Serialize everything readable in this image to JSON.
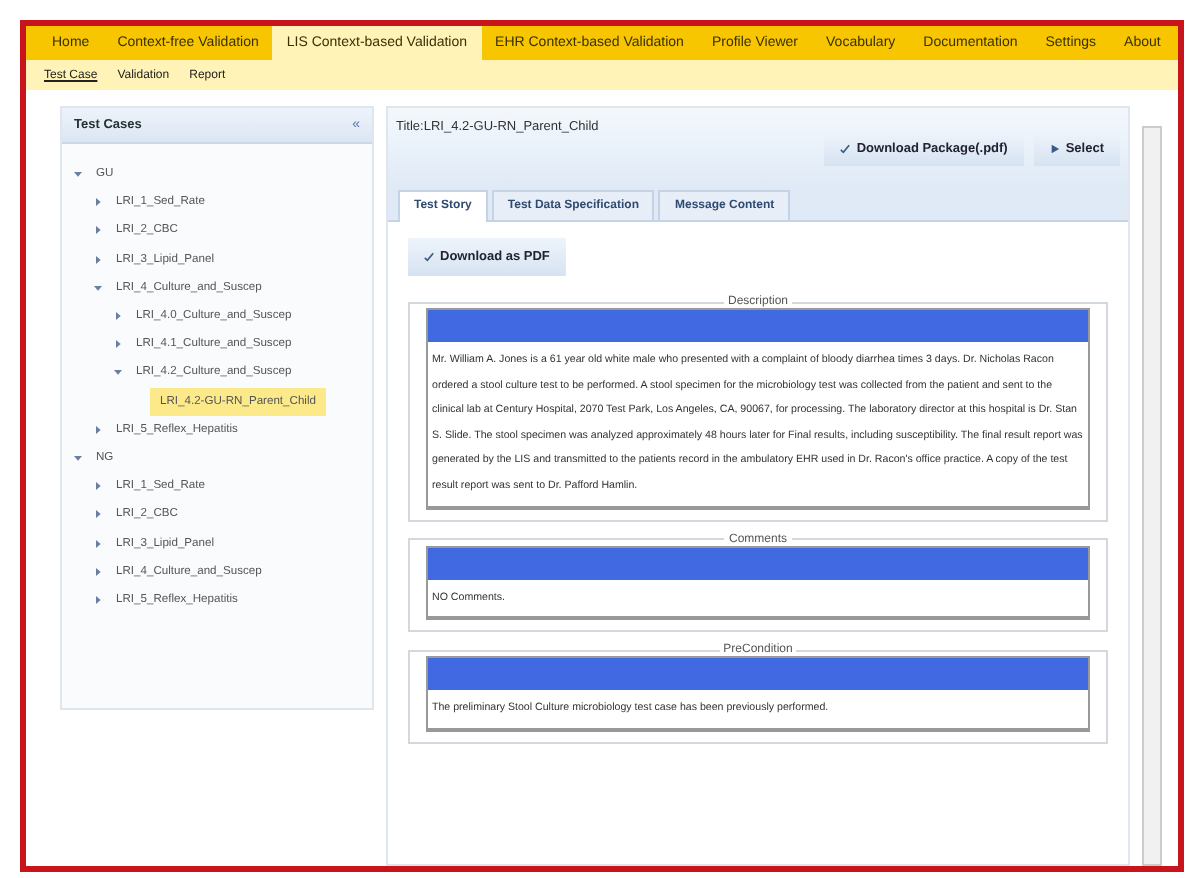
{
  "nav": [
    {
      "label": "Home",
      "selected": false
    },
    {
      "label": "Context-free Validation",
      "selected": false
    },
    {
      "label": "LIS Context-based Validation",
      "selected": true
    },
    {
      "label": "EHR Context-based Validation",
      "selected": false
    },
    {
      "label": "Profile Viewer",
      "selected": false
    },
    {
      "label": "Vocabulary",
      "selected": false
    },
    {
      "label": "Documentation",
      "selected": false
    },
    {
      "label": "Settings",
      "selected": false
    },
    {
      "label": "About",
      "selected": false
    }
  ],
  "subnav": [
    {
      "label": "Test Case",
      "selected": true
    },
    {
      "label": "Validation",
      "selected": false
    },
    {
      "label": "Report",
      "selected": false
    }
  ],
  "sidebar": {
    "title": "Test Cases",
    "collapse_icon": "«",
    "tree": [
      {
        "label": "GU",
        "expanded": true,
        "selected": false,
        "children": [
          {
            "label": "LRI_1_Sed_Rate",
            "expanded": false,
            "selected": false
          },
          {
            "label": "LRI_2_CBC",
            "expanded": false,
            "selected": false
          },
          {
            "label": "LRI_3_Lipid_Panel",
            "expanded": false,
            "selected": false
          },
          {
            "label": "LRI_4_Culture_and_Suscep",
            "expanded": true,
            "selected": false,
            "children": [
              {
                "label": "LRI_4.0_Culture_and_Suscep",
                "expanded": false,
                "selected": false
              },
              {
                "label": "LRI_4.1_Culture_and_Suscep",
                "expanded": false,
                "selected": false
              },
              {
                "label": "LRI_4.2_Culture_and_Suscep",
                "expanded": true,
                "selected": false,
                "children": [
                  {
                    "label": "LRI_4.2-GU-RN_Parent_Child",
                    "selected": true
                  }
                ]
              }
            ]
          },
          {
            "label": "LRI_5_Reflex_Hepatitis",
            "expanded": false,
            "selected": false
          }
        ]
      },
      {
        "label": "NG",
        "expanded": true,
        "selected": false,
        "children": [
          {
            "label": "LRI_1_Sed_Rate",
            "expanded": false,
            "selected": false
          },
          {
            "label": "LRI_2_CBC",
            "expanded": false,
            "selected": false
          },
          {
            "label": "LRI_3_Lipid_Panel",
            "expanded": false,
            "selected": false
          },
          {
            "label": "LRI_4_Culture_and_Suscep",
            "expanded": false,
            "selected": false
          },
          {
            "label": "LRI_5_Reflex_Hepatitis",
            "expanded": false,
            "selected": false
          }
        ]
      }
    ]
  },
  "main": {
    "title": "Title:LRI_4.2-GU-RN_Parent_Child",
    "buttons": [
      {
        "label": "Download Package(.pdf)",
        "kind": "download"
      },
      {
        "label": "Select",
        "kind": "select"
      }
    ],
    "tabs": [
      {
        "label": "Test Story",
        "selected": true
      },
      {
        "label": "Test Data Specification",
        "selected": false
      },
      {
        "label": "Message Content",
        "selected": false
      }
    ],
    "download_button": "Download as PDF",
    "sections": [
      {
        "legend": "Description",
        "text": "Mr. William A. Jones is a 61 year old white male who presented with a complaint of bloody diarrhea times 3 days. Dr. Nicholas Racon ordered a stool culture test to be performed. A stool specimen for the microbiology test was collected from the patient and sent to the clinical lab at Century Hospital, 2070 Test Park, Los Angeles, CA, 90067, for processing. The laboratory director at this hospital is Dr. Stan S. Slide. The stool specimen was analyzed approximately 48 hours later for Final results, including susceptibility. The final result report was generated by the LIS and transmitted to the patients record in the ambulatory EHR used in Dr. Racon's office practice. A copy of the test result report was sent to Dr. Pafford Hamlin."
      },
      {
        "legend": "Comments",
        "text": "NO Comments."
      },
      {
        "legend": "PreCondition",
        "text": "The preliminary Stool Culture microbiology test case has been previously performed."
      }
    ]
  }
}
